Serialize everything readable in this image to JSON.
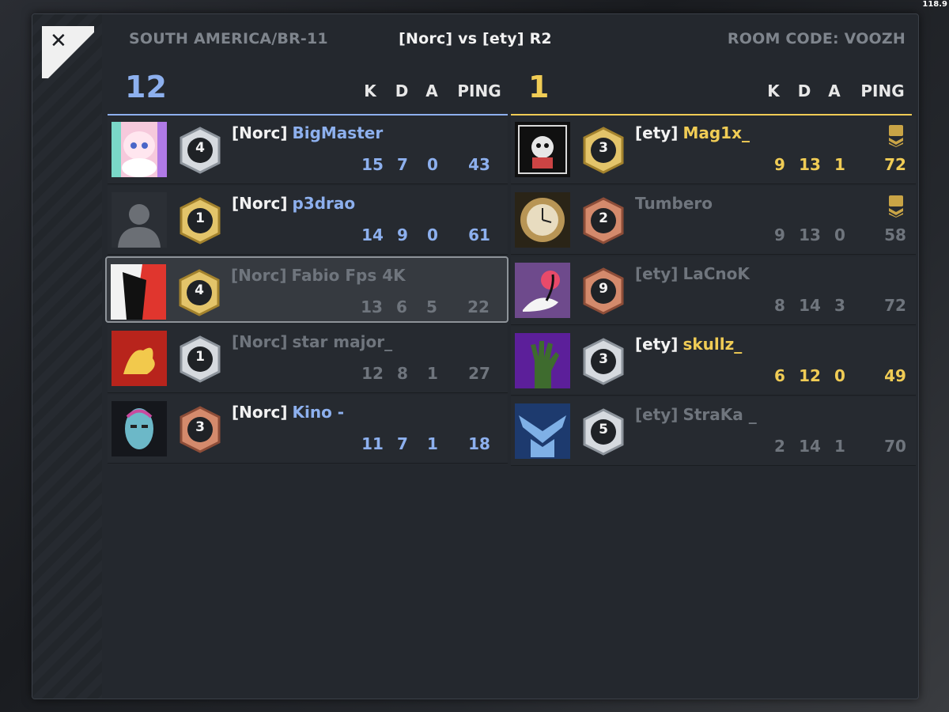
{
  "fps": "118.9",
  "header": {
    "server": "SOUTH AMERICA/BR-11",
    "match_title": "[Norc] vs [ety] R2",
    "room_code": "ROOM CODE: VOOZH"
  },
  "close_label": "✕",
  "columns": {
    "k": "K",
    "d": "D",
    "a": "A",
    "ping": "PING"
  },
  "team_a": {
    "score": "12",
    "color": "#8db0ee",
    "players": [
      {
        "tag": "[Norc]",
        "name": "BigMaster",
        "level": "4",
        "badge": "silver",
        "k": "15",
        "d": "7",
        "a": "0",
        "ping": "43",
        "active": true,
        "avatar": "anime-girl-avatar"
      },
      {
        "tag": "[Norc]",
        "name": "p3drao",
        "level": "1",
        "badge": "gold",
        "k": "14",
        "d": "9",
        "a": "0",
        "ping": "61",
        "active": true,
        "avatar": "default-silhouette-avatar"
      },
      {
        "tag": "[Norc]",
        "name": "Fabio Fps 4K",
        "level": "4",
        "badge": "gold",
        "k": "13",
        "d": "6",
        "a": "5",
        "ping": "22",
        "active": false,
        "selected": true,
        "avatar": "red-black-figure-avatar"
      },
      {
        "tag": "[Norc]",
        "name": "star major_",
        "level": "1",
        "badge": "silver",
        "k": "12",
        "d": "8",
        "a": "1",
        "ping": "27",
        "active": false,
        "avatar": "lion-crest-avatar"
      },
      {
        "tag": "[Norc]",
        "name": "Kino -",
        "level": "3",
        "badge": "bronze",
        "k": "11",
        "d": "7",
        "a": "1",
        "ping": "18",
        "active": true,
        "avatar": "robot-face-avatar"
      }
    ]
  },
  "team_b": {
    "score": "1",
    "color": "#f0cc55",
    "players": [
      {
        "tag": "[ety]",
        "name": "Mag1x_",
        "level": "3",
        "badge": "gold",
        "k": "9",
        "d": "13",
        "a": "1",
        "ping": "72",
        "active": true,
        "rank_icon": true,
        "avatar": "skull-art-avatar"
      },
      {
        "tag": "",
        "name": "Tumbero",
        "level": "2",
        "badge": "bronze",
        "k": "9",
        "d": "13",
        "a": "0",
        "ping": "58",
        "active": false,
        "rank_icon": true,
        "avatar": "clock-avatar"
      },
      {
        "tag": "[ety]",
        "name": "LaCnoK",
        "level": "9",
        "badge": "bronze",
        "k": "8",
        "d": "14",
        "a": "3",
        "ping": "72",
        "active": false,
        "avatar": "crane-avatar"
      },
      {
        "tag": "[ety]",
        "name": "skullz_",
        "level": "3",
        "badge": "silver",
        "k": "6",
        "d": "12",
        "a": "0",
        "ping": "49",
        "active": true,
        "avatar": "zombie-hand-avatar"
      },
      {
        "tag": "[ety]",
        "name": "StraKa _",
        "level": "5",
        "badge": "silver",
        "k": "2",
        "d": "14",
        "a": "1",
        "ping": "70",
        "active": false,
        "avatar": "wings-emblem-avatar"
      }
    ]
  },
  "colors": {
    "inactive_text": "#6f757d",
    "active_tag": "#f2f2f2",
    "gold_badge": "#c9a446",
    "silver_badge": "#a9b0b8",
    "bronze_badge": "#b06f55"
  }
}
